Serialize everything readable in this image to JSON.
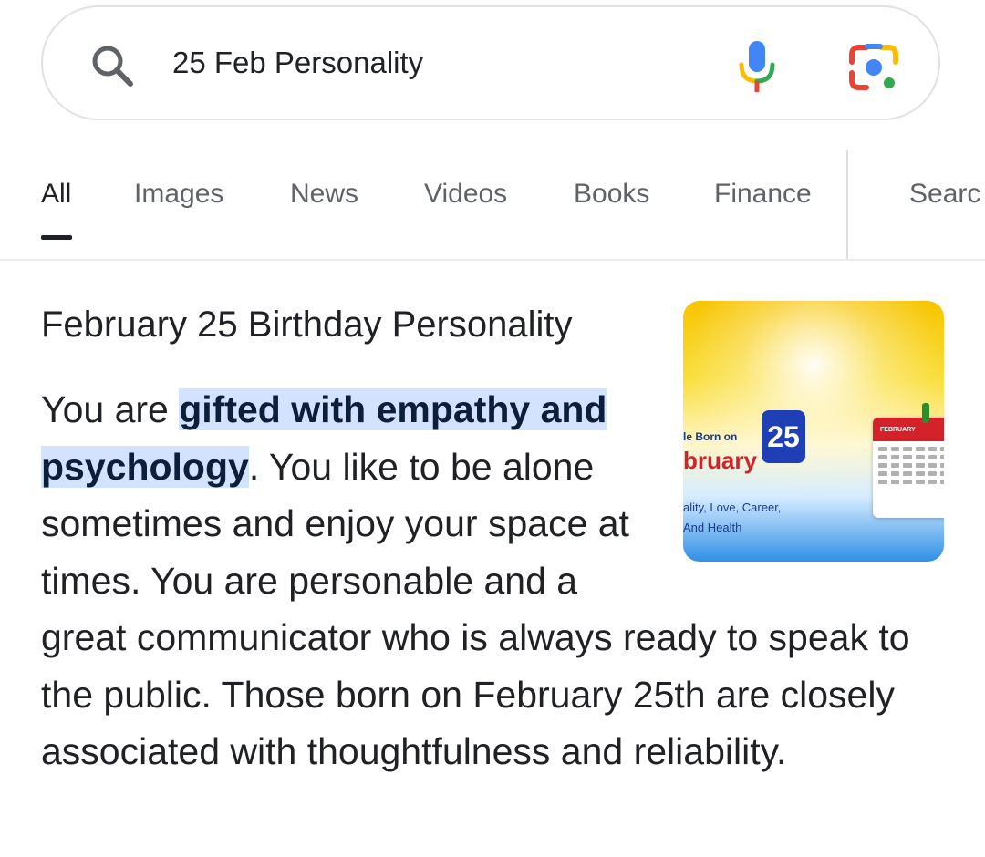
{
  "search": {
    "query": "25 Feb Personality",
    "icons": {
      "search": "search-icon",
      "mic": "mic-icon",
      "lens": "google-lens-icon"
    },
    "colors": {
      "blue": "#4285f4",
      "red": "#ea4335",
      "yellow": "#fbbc05",
      "green": "#34a853"
    }
  },
  "tabs": [
    {
      "label": "All",
      "active": true
    },
    {
      "label": "Images"
    },
    {
      "label": "News"
    },
    {
      "label": "Videos"
    },
    {
      "label": "Books"
    },
    {
      "label": "Finance"
    },
    {
      "label": "Searc"
    }
  ],
  "result": {
    "title": "February 25 Birthday Personality",
    "snippet_prefix": "You are ",
    "snippet_highlight": "gifted with empathy and psychology",
    "snippet_rest": ". You like to be alone sometimes and enjoy your space at times. You are personable and a great communicator who is always ready to speak to the public. Those born on February 25th are closely associated with thoughtfulness and reliability.",
    "highlight_color": "#d3e3fd",
    "thumbnail": {
      "line1": "le Born on",
      "line2": "bruary",
      "badge": "25",
      "line3": "ality, Love, Career,",
      "line4": "And Health",
      "calendar_month": "FEBRUARY"
    }
  }
}
